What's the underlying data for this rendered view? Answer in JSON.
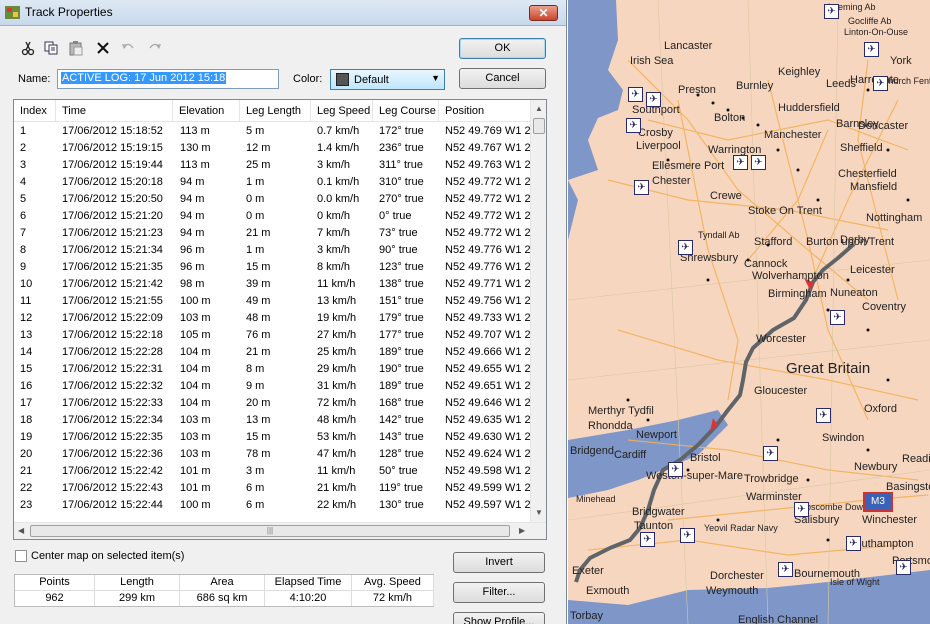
{
  "window": {
    "title": "Track Properties",
    "close_label": "✕"
  },
  "toolbar": {
    "cut_icon": "scissors-icon",
    "copy_icon": "copy-icon",
    "paste_icon": "paste-icon",
    "delete_icon": "delete-x-icon",
    "undo_icon": "undo-icon",
    "redo_icon": "redo-icon"
  },
  "form": {
    "name_label": "Name:",
    "name_value": "ACTIVE LOG: 17 Jun 2012 15:18",
    "color_label": "Color:",
    "color_value": "Default",
    "color_swatch": "#555555"
  },
  "buttons": {
    "ok": "OK",
    "cancel": "Cancel",
    "invert": "Invert",
    "filter": "Filter...",
    "show_profile": "Show Profile..."
  },
  "table": {
    "columns": [
      "Index",
      "Time",
      "Elevation",
      "Leg Length",
      "Leg Speed",
      "Leg Course",
      "Position"
    ],
    "rows": [
      [
        "1",
        "17/06/2012 15:18:52",
        "113 m",
        "5 m",
        "0.7 km/h",
        "172° true",
        "N52 49.769 W1 2"
      ],
      [
        "2",
        "17/06/2012 15:19:15",
        "130 m",
        "12 m",
        "1.4 km/h",
        "236° true",
        "N52 49.767 W1 2"
      ],
      [
        "3",
        "17/06/2012 15:19:44",
        "113 m",
        "25 m",
        "3 km/h",
        "311° true",
        "N52 49.763 W1 2"
      ],
      [
        "4",
        "17/06/2012 15:20:18",
        "94 m",
        "1 m",
        "0.1 km/h",
        "310° true",
        "N52 49.772 W1 2"
      ],
      [
        "5",
        "17/06/2012 15:20:50",
        "94 m",
        "0 m",
        "0.0 km/h",
        "270° true",
        "N52 49.772 W1 2"
      ],
      [
        "6",
        "17/06/2012 15:21:20",
        "94 m",
        "0 m",
        "0 km/h",
        "0° true",
        "N52 49.772 W1 2"
      ],
      [
        "7",
        "17/06/2012 15:21:23",
        "94 m",
        "21 m",
        "7 km/h",
        "73° true",
        "N52 49.772 W1 2"
      ],
      [
        "8",
        "17/06/2012 15:21:34",
        "96 m",
        "1 m",
        "3 km/h",
        "90° true",
        "N52 49.776 W1 2"
      ],
      [
        "9",
        "17/06/2012 15:21:35",
        "96 m",
        "15 m",
        "8 km/h",
        "123° true",
        "N52 49.776 W1 2"
      ],
      [
        "10",
        "17/06/2012 15:21:42",
        "98 m",
        "39 m",
        "11 km/h",
        "138° true",
        "N52 49.771 W1 2"
      ],
      [
        "11",
        "17/06/2012 15:21:55",
        "100 m",
        "49 m",
        "13 km/h",
        "151° true",
        "N52 49.756 W1 2"
      ],
      [
        "12",
        "17/06/2012 15:22:09",
        "103 m",
        "48 m",
        "19 km/h",
        "179° true",
        "N52 49.733 W1 2"
      ],
      [
        "13",
        "17/06/2012 15:22:18",
        "105 m",
        "76 m",
        "27 km/h",
        "177° true",
        "N52 49.707 W1 2"
      ],
      [
        "14",
        "17/06/2012 15:22:28",
        "104 m",
        "21 m",
        "25 km/h",
        "189° true",
        "N52 49.666 W1 2"
      ],
      [
        "15",
        "17/06/2012 15:22:31",
        "104 m",
        "8 m",
        "29 km/h",
        "190° true",
        "N52 49.655 W1 2"
      ],
      [
        "16",
        "17/06/2012 15:22:32",
        "104 m",
        "9 m",
        "31 km/h",
        "189° true",
        "N52 49.651 W1 2"
      ],
      [
        "17",
        "17/06/2012 15:22:33",
        "104 m",
        "20 m",
        "72 km/h",
        "168° true",
        "N52 49.646 W1 2"
      ],
      [
        "18",
        "17/06/2012 15:22:34",
        "103 m",
        "13 m",
        "48 km/h",
        "142° true",
        "N52 49.635 W1 2"
      ],
      [
        "19",
        "17/06/2012 15:22:35",
        "103 m",
        "15 m",
        "53 km/h",
        "143° true",
        "N52 49.630 W1 2"
      ],
      [
        "20",
        "17/06/2012 15:22:36",
        "103 m",
        "78 m",
        "47 km/h",
        "128° true",
        "N52 49.624 W1 2"
      ],
      [
        "21",
        "17/06/2012 15:22:42",
        "101 m",
        "3 m",
        "11 km/h",
        "50° true",
        "N52 49.598 W1 2"
      ],
      [
        "22",
        "17/06/2012 15:22:43",
        "101 m",
        "6 m",
        "21 km/h",
        "119° true",
        "N52 49.599 W1 2"
      ],
      [
        "23",
        "17/06/2012 15:22:44",
        "100 m",
        "6 m",
        "22 km/h",
        "130° true",
        "N52 49.597 W1 2"
      ]
    ]
  },
  "options": {
    "center_map_label": "Center map on selected item(s)",
    "center_map_checked": false
  },
  "stats": {
    "headers": [
      "Points",
      "Length",
      "Area",
      "Elapsed Time",
      "Avg. Speed"
    ],
    "values": [
      "962",
      "299 km",
      "686 sq km",
      "4:10:20",
      "72 km/h"
    ]
  },
  "map": {
    "region_label": "Great Britain",
    "motorway_label": "M3",
    "places": [
      "Lancaster",
      "Irish Sea",
      "Keighley",
      "Harrogate",
      "York",
      "Preston",
      "Burnley",
      "Leeds",
      "Southport",
      "Bolton",
      "Huddersfield",
      "Barnsley",
      "Doncaster",
      "Crosby",
      "Liverpool",
      "Warrington",
      "Manchester",
      "Sheffield",
      "Ellesmere Port",
      "Chester",
      "Chesterfield",
      "Mansfield",
      "Crewe",
      "Stoke On Trent",
      "Derby",
      "Nottingham",
      "Stafford",
      "Burton upon Trent",
      "Shrewsbury",
      "Cannock",
      "Wolverhampton",
      "Leicester",
      "Birmingham",
      "Nuneaton",
      "Coventry",
      "Worcester",
      "Gloucester",
      "Oxford",
      "Merthyr Tydfil",
      "Rhondda",
      "Newport",
      "Swindon",
      "Bridgend",
      "Cardiff",
      "Bristol",
      "Newbury",
      "Reading",
      "Weston-super-Mare",
      "Trowbridge",
      "Warminster",
      "Basingstoke",
      "Minehead",
      "Bridgwater",
      "Salisbury",
      "Winchester",
      "Taunton",
      "Yeovil Radar Navy",
      "Southampton",
      "Exeter",
      "Exmouth",
      "Dorchester",
      "Weymouth",
      "Bournemouth",
      "Portsmouth",
      "Torbay",
      "Isle of Wight",
      "English Channel",
      "Leeming Ab",
      "Gocliffe Ab",
      "Linton-On-Ouse",
      "Church Fenton",
      "Tyndall Ab",
      "Boscombe Down"
    ],
    "water_color": "#7e96c8",
    "land_color": "#f7d6c0",
    "track_color": "#5f6468"
  }
}
